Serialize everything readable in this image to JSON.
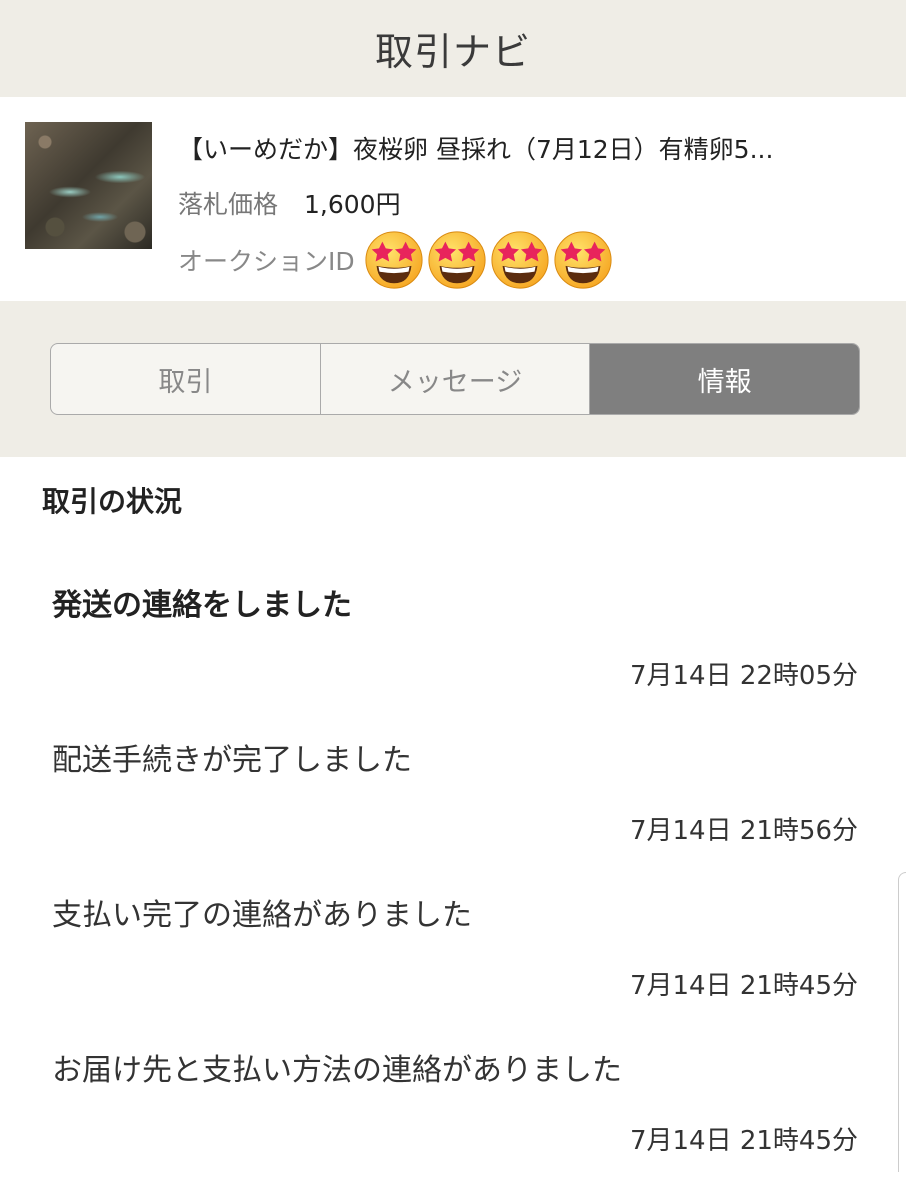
{
  "header": {
    "title": "取引ナビ"
  },
  "item": {
    "thumbnail_icon": "medaka-fish-photo",
    "title": "【いーめだか】夜桜卵 昼採れ（7月12日）有精卵5...",
    "price_label": "落札価格",
    "price_value": "1,600円",
    "auction_id_label": "オークションID",
    "auction_id_masked_by": [
      "star-struck-emoji",
      "star-struck-emoji",
      "star-struck-emoji",
      "star-struck-emoji"
    ]
  },
  "tabs": [
    {
      "label": "取引",
      "active": false
    },
    {
      "label": "メッセージ",
      "active": false
    },
    {
      "label": "情報",
      "active": true
    }
  ],
  "status": {
    "title": "取引の状況",
    "events": [
      {
        "text": "発送の連絡をしました",
        "time": "7月14日 22時05分",
        "bold": true
      },
      {
        "text": "配送手続きが完了しました",
        "time": "7月14日 21時56分",
        "bold": false
      },
      {
        "text": "支払い完了の連絡がありました",
        "time": "7月14日 21時45分",
        "bold": false
      },
      {
        "text": "お届け先と支払い方法の連絡がありました",
        "time": "7月14日 21時45分",
        "bold": false
      }
    ]
  },
  "colors": {
    "header_bg": "#efede6",
    "active_tab_bg": "#7f7f7f",
    "text": "#333333"
  }
}
